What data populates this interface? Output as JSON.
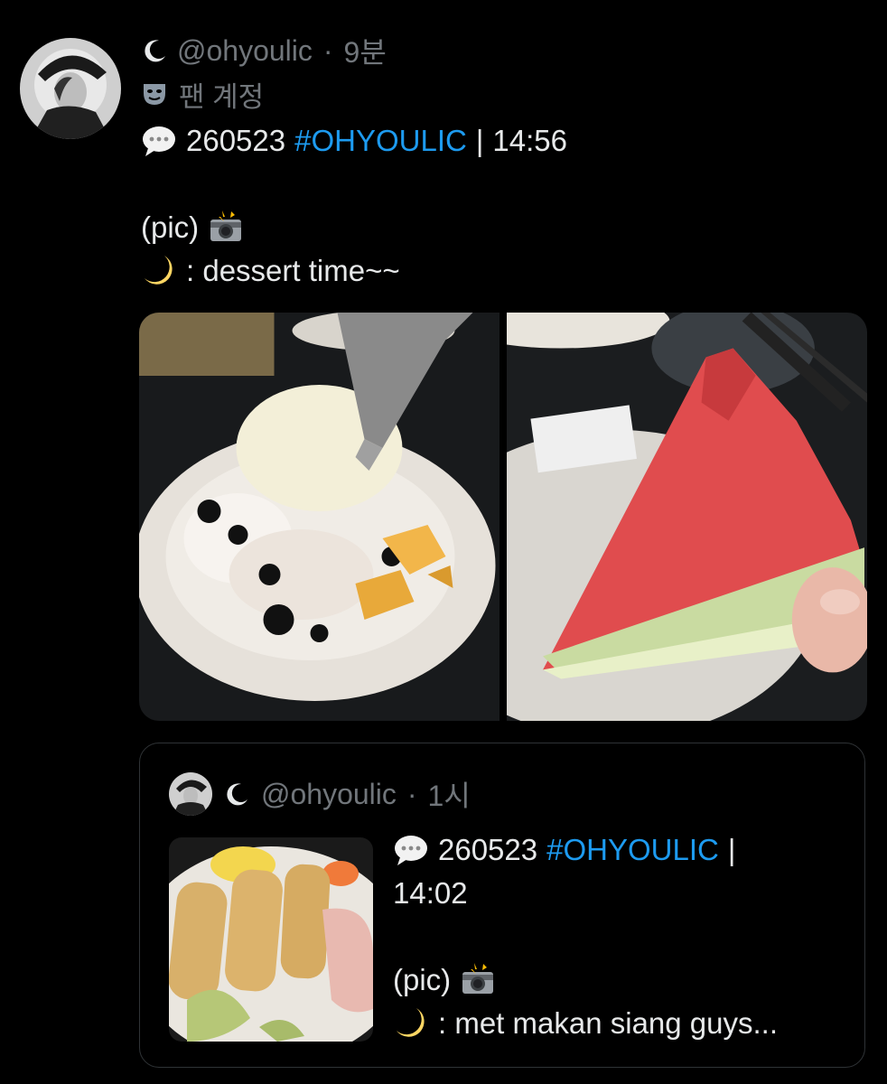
{
  "post": {
    "handle": "@ohyoulic",
    "separator": "·",
    "time": "9분",
    "account_label": "팬 계정",
    "icons": [
      "moon-icon",
      "theater-mask-icon",
      "speech-bubble-icon",
      "camera-flash-icon",
      "crescent-moon-icon"
    ],
    "date_code": "260523",
    "hashtag": "#OHYOULIC",
    "divider": "|",
    "clock": "14:56",
    "pic_label": "(pic)",
    "caption": ": dessert time~~",
    "media_alt": [
      "ice cream bowl photo",
      "watermelon slice photo"
    ]
  },
  "quote": {
    "handle": "@ohyoulic",
    "separator": "·",
    "time": "1시",
    "date_code": "260523",
    "hashtag": "#OHYOULIC",
    "divider": "|",
    "clock": "14:02",
    "pic_label": "(pic)",
    "caption": ": met makan siang guys..."
  },
  "colors": {
    "background": "#000000",
    "text": "#e7e9ea",
    "muted": "#71767b",
    "link": "#1d9bf0",
    "border": "#2f3336"
  }
}
